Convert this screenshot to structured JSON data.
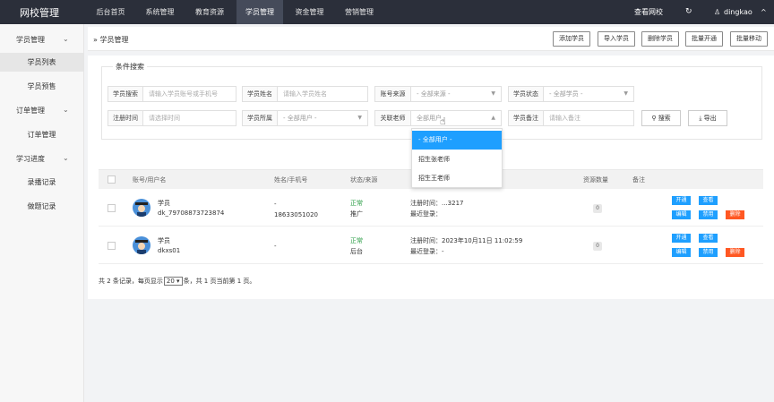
{
  "topbar": {
    "brand": "网校管理",
    "nav": [
      "后台首页",
      "系统管理",
      "教育资源",
      "学员管理",
      "资金管理",
      "营销管理"
    ],
    "active_nav": "学员管理",
    "view_site": "查看网校",
    "refresh_icon": "refresh-icon",
    "username": "dingkao",
    "user_icon": "user-icon",
    "chevron": "^"
  },
  "sidebar": {
    "groups": [
      {
        "label": "学员管理",
        "items": [
          "学员列表",
          "学员预售"
        ]
      },
      {
        "label": "订单管理",
        "items": [
          "订单管理"
        ]
      },
      {
        "label": "学习进度",
        "items": [
          "录播记录",
          "做题记录"
        ]
      }
    ],
    "active_item": "学员列表"
  },
  "breadcrumb": "学员管理",
  "toolbar": {
    "buttons": [
      "添加学员",
      "导入学员",
      "删除学员",
      "批量开通",
      "批量移动"
    ]
  },
  "filter": {
    "legend": "条件搜索",
    "row1": [
      {
        "label": "学员搜索",
        "placeholder": "请输入学员账号或手机号"
      },
      {
        "label": "学员姓名",
        "placeholder": "请输入学员姓名"
      },
      {
        "label": "账号来源",
        "value": "- 全部来源 -"
      },
      {
        "label": "学员状态",
        "value": "- 全部学员 -"
      }
    ],
    "row2": [
      {
        "label": "注册时间",
        "placeholder": "请选择时间"
      },
      {
        "label": "学员所属",
        "value": "- 全部用户 -"
      },
      {
        "label": "关联老师",
        "value": "全部用户"
      },
      {
        "label": "学员备注",
        "placeholder": "请输入备注"
      }
    ],
    "search_label": "搜索",
    "export_label": "导出"
  },
  "dropdown": {
    "options": [
      "- 全部用户 -",
      "招生张老师",
      "招生王老师"
    ],
    "selected": "- 全部用户 -"
  },
  "table": {
    "headers": [
      "账号/用户名",
      "姓名/手机号",
      "状态/来源",
      "",
      "资源数量",
      "备注"
    ],
    "rows": [
      {
        "account": "学员",
        "username": "dk_79708873723874",
        "name": "-",
        "phone": "18633051020",
        "status": "正常",
        "source": "推广",
        "reg_time": "注册时间：...3217",
        "last_login": "最近登录：",
        "resources": "0",
        "ops_row1": [
          "开通",
          "查看"
        ],
        "ops_row2": [
          "编辑",
          "禁用",
          "删除"
        ]
      },
      {
        "account": "学员",
        "username": "dkxs01",
        "name": "-",
        "phone": "",
        "status": "正常",
        "source": "后台",
        "reg_time": "注册时间：2023年10月11日 11:02:59",
        "last_login": "最近登录：-",
        "resources": "0",
        "ops_row1": [
          "开通",
          "查看"
        ],
        "ops_row2": [
          "编辑",
          "禁用",
          "删除"
        ]
      }
    ]
  },
  "pager": {
    "prefix": "共 2 条记录，每页显示",
    "per_page": "20",
    "suffix": "条，共 1 页当前第 1 页。"
  },
  "colors": {
    "topbar": "#2b2f3a",
    "primary": "#1e9fff",
    "danger": "#ff5722",
    "status_ok": "#2a9d44"
  }
}
